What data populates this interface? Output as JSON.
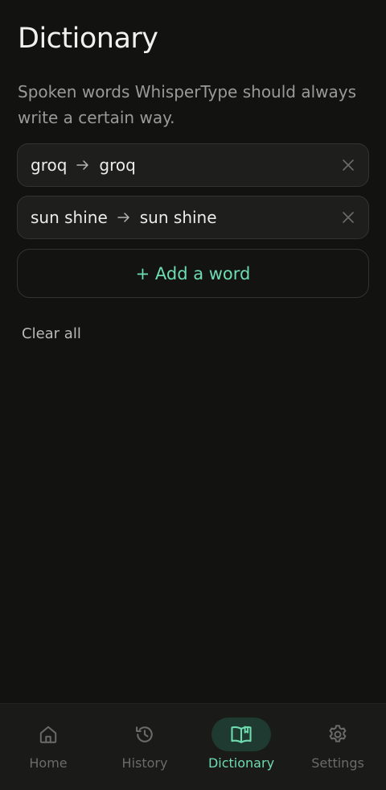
{
  "page": {
    "title": "Dictionary",
    "subtitle": "Spoken words WhisperType should always write a certain way."
  },
  "entries": [
    {
      "spoken": "groq",
      "written": "groq"
    },
    {
      "spoken": "sun shine",
      "written": "sun shine"
    }
  ],
  "actions": {
    "add_label": "+ Add a word",
    "clear_label": "Clear all"
  },
  "nav": {
    "items": [
      {
        "label": "Home",
        "icon": "home-icon",
        "active": false
      },
      {
        "label": "History",
        "icon": "history-icon",
        "active": false
      },
      {
        "label": "Dictionary",
        "icon": "book-icon",
        "active": true
      },
      {
        "label": "Settings",
        "icon": "gear-icon",
        "active": false
      }
    ]
  },
  "colors": {
    "background": "#121211",
    "accent": "#6fdcb0",
    "active_pill": "#1f3a30"
  }
}
